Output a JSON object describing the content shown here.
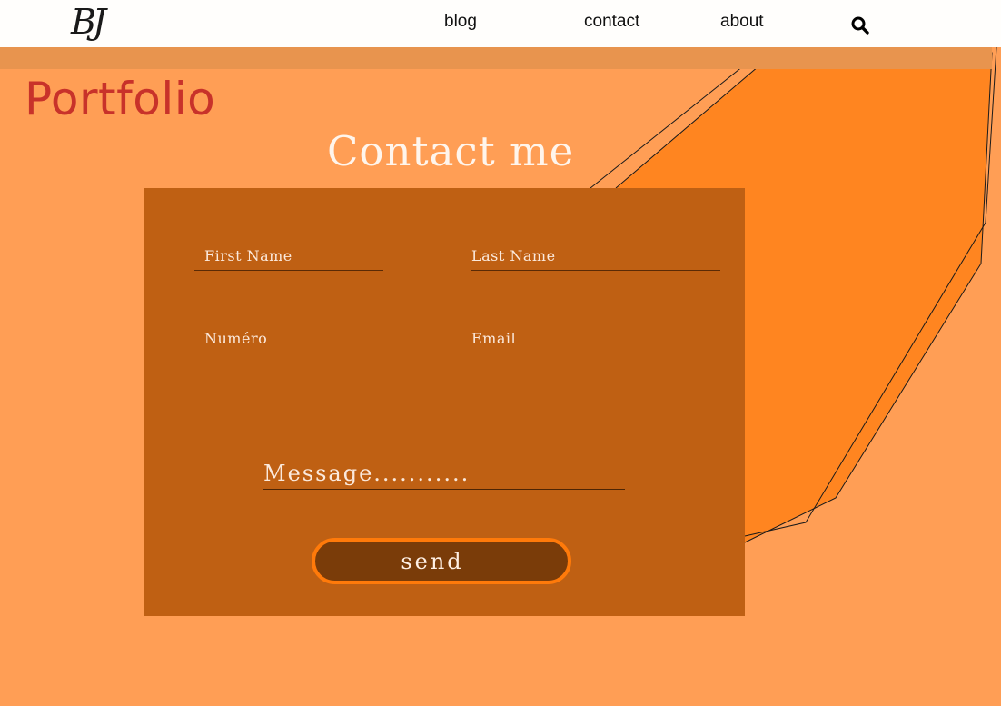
{
  "nav": {
    "logo": "BJ",
    "links": [
      "blog",
      "contact",
      "about"
    ]
  },
  "icons": {
    "search": "search-icon"
  },
  "page": {
    "title": "Portfolio"
  },
  "contact": {
    "title": "Contact me",
    "first_name_placeholder": "First Name",
    "last_name_placeholder": "Last Name",
    "phone_placeholder": "Numéro",
    "email_placeholder": "Email",
    "message_placeholder": "Message...........",
    "send_label": "send"
  },
  "colors": {
    "background": "#ff9e55",
    "navbar": "#fffefc",
    "panel": "#bf6013",
    "accent": "#ff7a0a",
    "button": "#7a3c09",
    "title": "#c8322a",
    "shape": "#ff8520"
  }
}
